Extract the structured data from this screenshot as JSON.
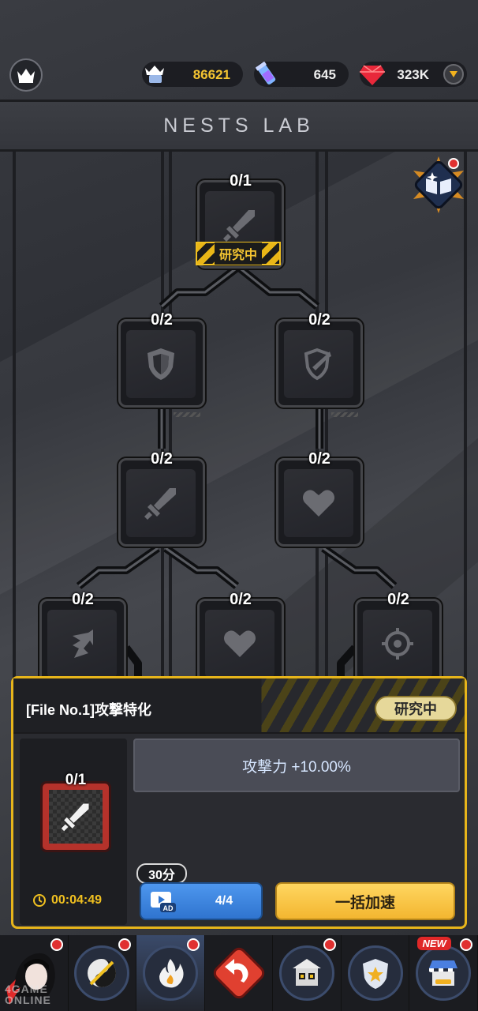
{
  "header": {
    "crown_count": "86621",
    "potion_count": "645",
    "gem_count": "323K"
  },
  "title": "NESTS LAB",
  "tree": {
    "nodes": [
      {
        "id": "root",
        "count": "0/1",
        "icon": "sword-icon"
      },
      {
        "id": "shield",
        "count": "0/2",
        "icon": "shield-icon"
      },
      {
        "id": "counter",
        "count": "0/2",
        "icon": "counter-shield-icon"
      },
      {
        "id": "sword2",
        "count": "0/2",
        "icon": "sword-icon"
      },
      {
        "id": "heart",
        "count": "0/2",
        "icon": "heart-icon"
      },
      {
        "id": "arrow",
        "count": "0/2",
        "icon": "arrow-burst-icon"
      },
      {
        "id": "heart2",
        "count": "0/2",
        "icon": "heart-icon"
      },
      {
        "id": "target",
        "count": "0/2",
        "icon": "crosshair-icon"
      }
    ],
    "research_tag": "研究中"
  },
  "panel": {
    "title": "[File No.1]攻撃特化",
    "status": "研究中",
    "node_count": "0/1",
    "timer": "00:04:49",
    "effect": "攻撃力 +10.00%",
    "time_bubble": "30分",
    "ad_count": "4/4",
    "ad_label": "AD",
    "speedup_label": "一括加速"
  },
  "nav": {
    "new_badge": "NEW"
  },
  "watermark": {
    "line1": "4GAME",
    "line2": "ONLINE"
  },
  "colors": {
    "accent": "#e7b51b",
    "ad_button": "#3f86e0",
    "speedup_button": "#f7c340",
    "alert": "#e03030"
  }
}
